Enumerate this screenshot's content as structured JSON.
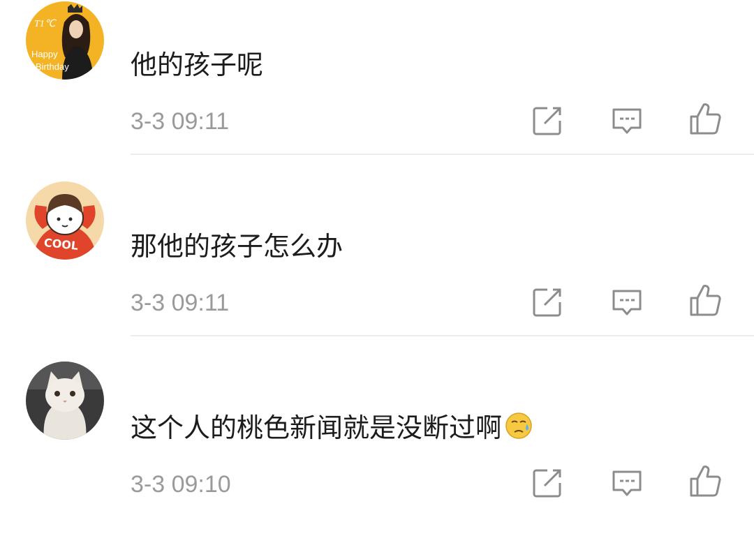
{
  "comments": [
    {
      "avatar_desc": "happy-birthday-portrait",
      "avatar_text_top": "T1℃",
      "avatar_text_happy": "Happy",
      "avatar_text_birthday": "Birthday",
      "text": "他的孩子呢",
      "time": "3-3 09:11"
    },
    {
      "avatar_desc": "cool-cartoon-character",
      "avatar_text": "COOL",
      "text": "那他的孩子怎么办",
      "time": "3-3 09:11"
    },
    {
      "avatar_desc": "white-cat-photo",
      "text": "这个人的桃色新闻就是没断过啊",
      "emoji": "sweat-face-emoji",
      "time": "3-3 09:10"
    }
  ],
  "actions": {
    "share_icon": "share-edit-icon",
    "reply_icon": "comment-reply-icon",
    "like_icon": "thumbs-up-icon"
  },
  "colors": {
    "timestamp": "#9a9a9a",
    "divider": "#ececec",
    "icon": "#8c8c8c",
    "avatar1_bg": "#f4b324",
    "avatar2_bg": "#f6d9a8",
    "avatar3_bg": "#3a3a3a"
  }
}
